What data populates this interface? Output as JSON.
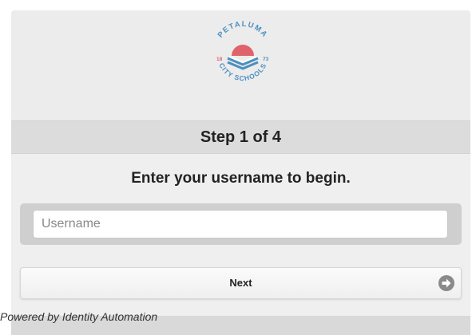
{
  "logo": {
    "top_text": "PETALUMA",
    "bottom_text": "CITY SCHOOLS",
    "year_left": "18",
    "year_right": "73",
    "colors": {
      "text": "#4a8fc0",
      "sun": "#e0626a",
      "book": "#4a8fc0"
    }
  },
  "step": {
    "label": "Step 1 of 4"
  },
  "prompt": {
    "text": "Enter your username to begin."
  },
  "username": {
    "placeholder": "Username",
    "value": ""
  },
  "next_button": {
    "label": "Next",
    "icon": "arrow-right-circle-icon"
  },
  "footer": {
    "text": "Powered by Identity Automation"
  }
}
